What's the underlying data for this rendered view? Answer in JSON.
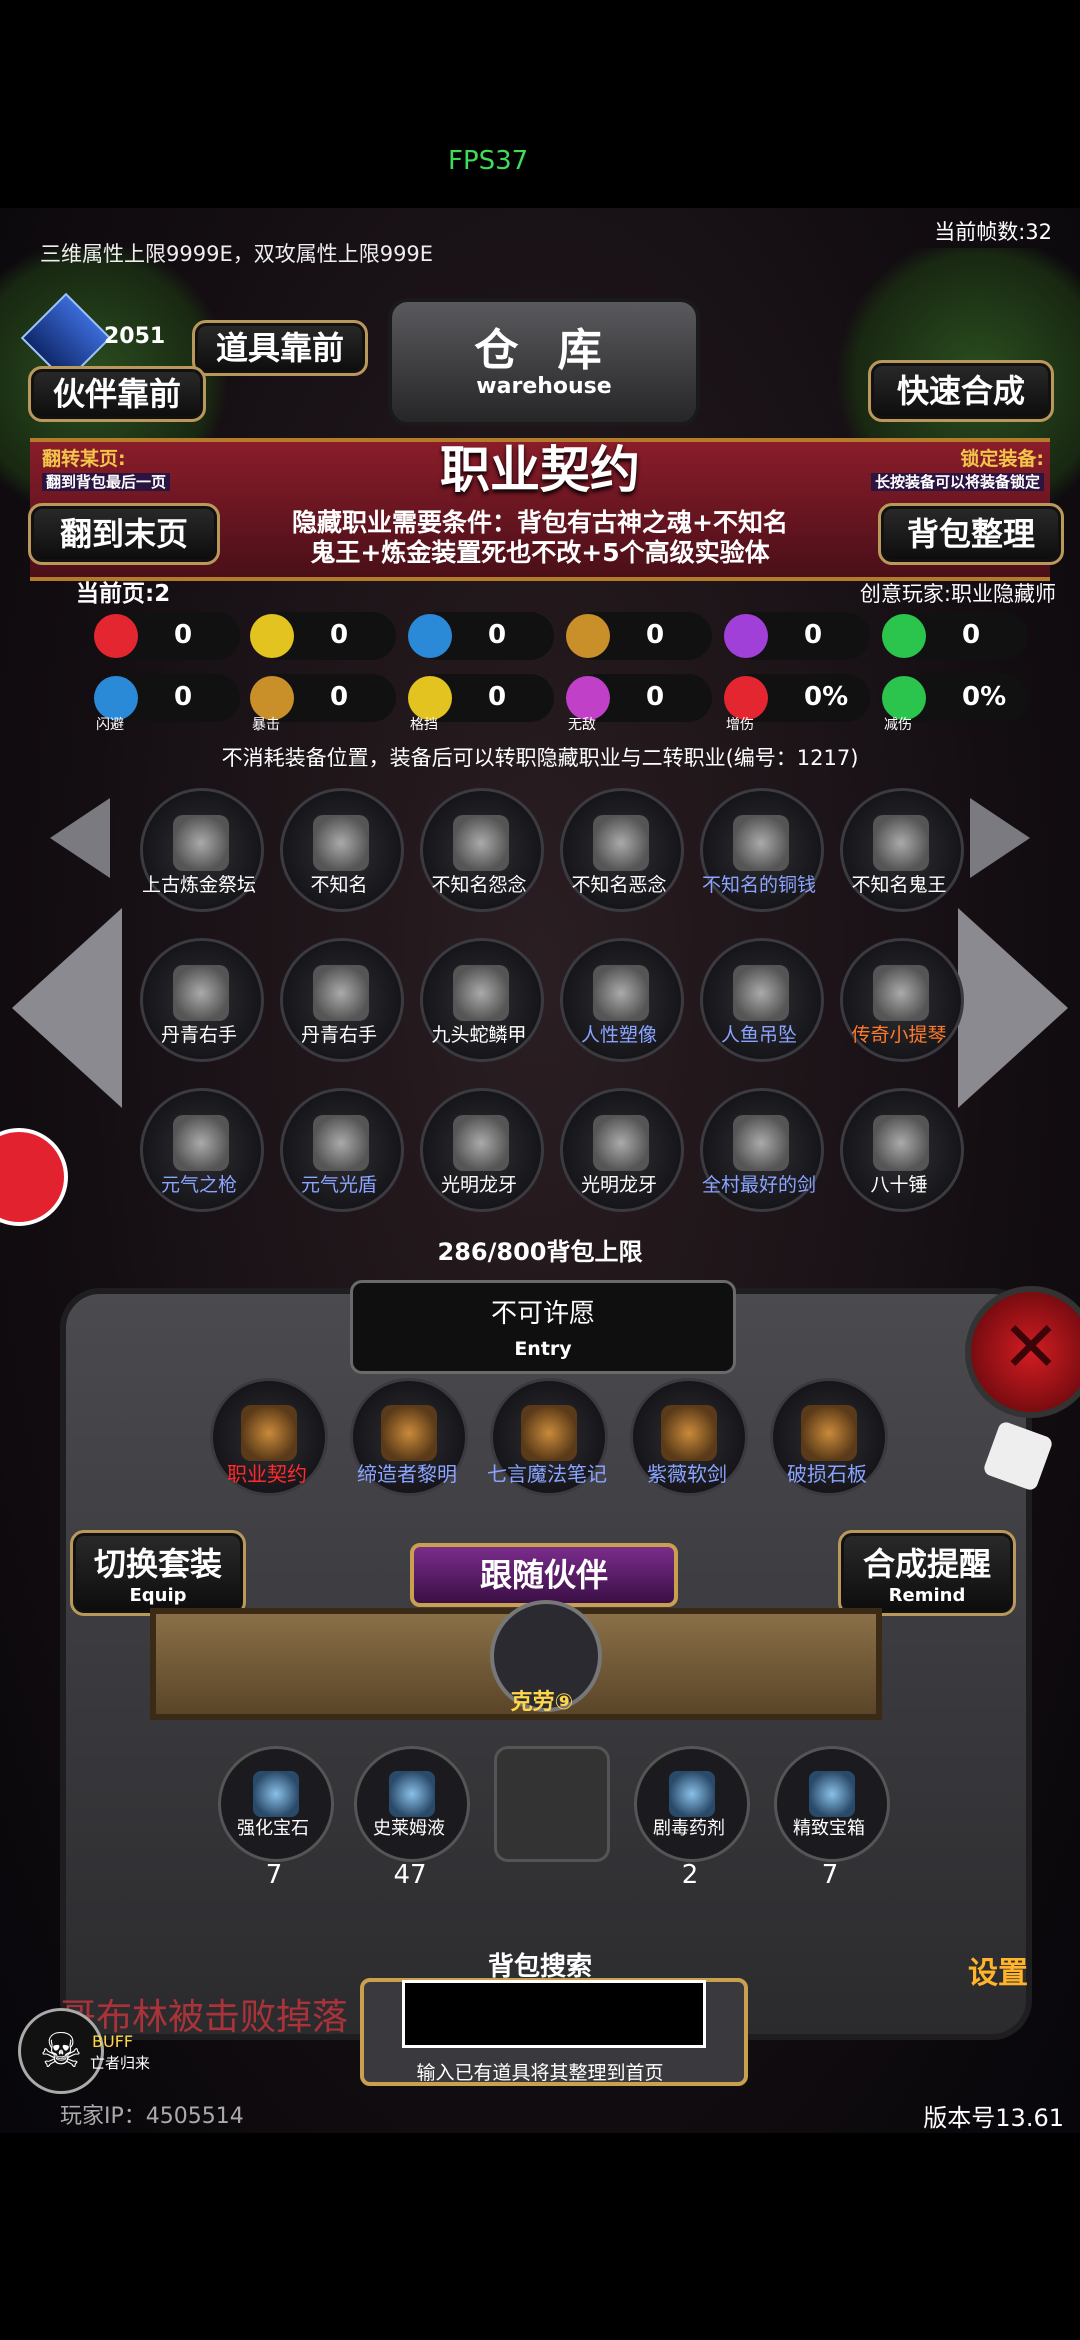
{
  "status_bar": {
    "fps": "FPS37"
  },
  "header": {
    "attr_limit": "三维属性上限9999E，双攻属性上限999E",
    "current_fps": "当前帧数:32",
    "currency_value": "2051",
    "btn_item_front": "道具靠前",
    "btn_partner_front": "伙伴靠前",
    "warehouse_cn": "仓 库",
    "warehouse_en": "warehouse",
    "btn_quick_craft": "快速合成"
  },
  "section": {
    "title": "职业契约",
    "jump_label": "翻转某页:",
    "jump_sub": "翻到背包最后一页",
    "lock_label": "锁定装备:",
    "lock_sub": "长按装备可以将装备锁定",
    "btn_last_page": "翻到末页",
    "btn_sort": "背包整理",
    "requirement_line1": "隐藏职业需要条件：背包有古神之魂+不知名",
    "requirement_line2": "鬼王+炼金装置死也不改+5个高级实验体",
    "current_page": "当前页:2",
    "creator": "创意玩家:职业隐藏师",
    "description": "不消耗装备位置，装备后可以转职隐藏职业与二转职业(编号：1217)"
  },
  "stats_row1": [
    {
      "icon": "heart-icon",
      "color": "#e3262f",
      "value": "0"
    },
    {
      "icon": "strength-icon",
      "color": "#e3c31f",
      "value": "0"
    },
    {
      "icon": "armor-icon",
      "color": "#2a8ad8",
      "value": "0"
    },
    {
      "icon": "weapon-icon",
      "color": "#c9902a",
      "value": "0"
    },
    {
      "icon": "lightning-icon",
      "color": "#a040d8",
      "value": "0"
    },
    {
      "icon": "clover-icon",
      "color": "#2bc44d",
      "value": "0"
    }
  ],
  "stats_row2": [
    {
      "icon": "dodge-icon",
      "color": "#2a8ad8",
      "label": "闪避",
      "value": "0"
    },
    {
      "icon": "crit-icon",
      "color": "#c9902a",
      "label": "暴击",
      "value": "0"
    },
    {
      "icon": "block-icon",
      "color": "#e3c31f",
      "label": "格挡",
      "value": "0"
    },
    {
      "icon": "invincible-icon",
      "color": "#c040c8",
      "label": "无敌",
      "value": "0"
    },
    {
      "icon": "damage-up-icon",
      "color": "#e3262f",
      "label": "增伤",
      "value": "0%"
    },
    {
      "icon": "damage-down-icon",
      "color": "#2bc44d",
      "label": "减伤",
      "value": "0%"
    }
  ],
  "inventory": [
    {
      "name": "上古炼金祭坛",
      "color": "#ffffff",
      "icon": "skull-pile-icon"
    },
    {
      "name": "不知名",
      "color": "#ffffff",
      "icon": "fire-spirit-icon"
    },
    {
      "name": "不知名怨念",
      "color": "#ffffff",
      "icon": "ghost-icon"
    },
    {
      "name": "不知名恶念",
      "color": "#ffffff",
      "icon": "specter-icon"
    },
    {
      "name": "不知名的铜钱",
      "color": "#8aa4ff",
      "icon": "coin-icon"
    },
    {
      "name": "不知名鬼王",
      "color": "#ffffff",
      "icon": "ghost-king-icon"
    },
    {
      "name": "丹青右手",
      "color": "#ffffff",
      "icon": "glove-icon"
    },
    {
      "name": "丹青右手",
      "color": "#ffffff",
      "icon": "glove-icon"
    },
    {
      "name": "九头蛇鳞甲",
      "color": "#ffffff",
      "icon": "hydra-armor-icon"
    },
    {
      "name": "人性塑像",
      "color": "#8aa4ff",
      "icon": "statue-icon"
    },
    {
      "name": "人鱼吊坠",
      "color": "#8aa4ff",
      "icon": "pendant-icon"
    },
    {
      "name": "传奇小提琴",
      "color": "#ff7a2a",
      "icon": "violin-icon"
    },
    {
      "name": "元气之枪",
      "color": "#8aa4ff",
      "icon": "spear-icon"
    },
    {
      "name": "元气光盾",
      "color": "#8aa4ff",
      "icon": "shield-icon"
    },
    {
      "name": "光明龙牙",
      "color": "#ffffff",
      "icon": "fang-icon"
    },
    {
      "name": "光明龙牙",
      "color": "#ffffff",
      "icon": "fang-icon"
    },
    {
      "name": "全村最好的剑",
      "color": "#8aa4ff",
      "icon": "sword-icon"
    },
    {
      "name": "八十锤",
      "color": "#ffffff",
      "icon": "hammer-icon"
    }
  ],
  "bag_limit": "286/800背包上限",
  "entry": {
    "title": "不可许愿",
    "subtitle": "Entry"
  },
  "equipped": [
    {
      "name": "职业契约",
      "color": "#ff2a2a",
      "icon": "scroll-icon"
    },
    {
      "name": "缔造者黎明",
      "color": "#8aa4ff",
      "icon": "hilt-icon"
    },
    {
      "name": "七言魔法笔记",
      "color": "#8aa4ff",
      "icon": "book-icon"
    },
    {
      "name": "紫薇软剑",
      "color": "#8aa4ff",
      "icon": "soft-sword-icon"
    },
    {
      "name": "破损石板",
      "color": "#8aa4ff",
      "icon": "gem-slab-icon"
    }
  ],
  "equip_btn": {
    "label": "切换套装",
    "sub": "Equip"
  },
  "remind_btn": {
    "label": "合成提醒",
    "sub": "Remind"
  },
  "companion": {
    "title": "跟随伙伴",
    "name": "克劳⑨"
  },
  "consumables": [
    {
      "name": "强化宝石",
      "count": "7",
      "icon": "green-gem-icon"
    },
    {
      "name": "史莱姆液",
      "count": "47",
      "icon": "potion-icon"
    },
    {
      "name": "",
      "count": "",
      "icon": "empty-slot-icon"
    },
    {
      "name": "剧毒药剂",
      "count": "2",
      "icon": "poison-icon"
    },
    {
      "name": "精致宝箱",
      "count": "7",
      "icon": "chest-icon"
    }
  ],
  "search": {
    "title": "背包搜索",
    "hint": "输入已有道具将其整理到首页",
    "value": ""
  },
  "footer": {
    "ticker": "哥布林被击败掉落",
    "buff_label": "BUFF",
    "buff_sub": "亡者归来",
    "player_ip": "玩家IP：4505514",
    "version": "版本号13.61",
    "settings": "设置"
  }
}
